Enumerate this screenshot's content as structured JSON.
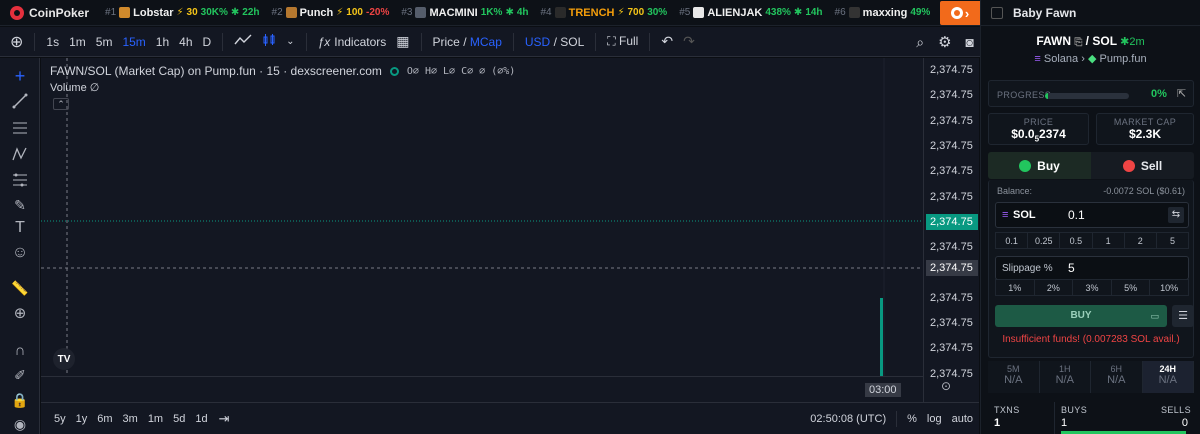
{
  "ticker": {
    "brand": "CoinPoker",
    "items": [
      {
        "rank": "#1",
        "symbol": "Lobstar",
        "cap": "30",
        "change": "30K%",
        "age": "22h",
        "dir": "up",
        "thumb": "#d08a2c"
      },
      {
        "rank": "#2",
        "symbol": "Punch",
        "cap": "100",
        "change": "-20%",
        "age": "",
        "dir": "down",
        "thumb": "#b5782f"
      },
      {
        "rank": "#3",
        "symbol": "MACMINI",
        "cap": "",
        "change": "1K%",
        "age": "4h",
        "dir": "up",
        "thumb": "#555d6b"
      },
      {
        "rank": "#4",
        "symbol": "TRENCH",
        "cap": "700",
        "change": "30%",
        "age": "",
        "dir": "up",
        "thumb": "#2a2a2a",
        "symbol_color": "#f59e0b"
      },
      {
        "rank": "#5",
        "symbol": "ALIENJAK",
        "cap": "",
        "change": "438%",
        "age": "14h",
        "dir": "up",
        "thumb": "#e8e8e8"
      },
      {
        "rank": "#6",
        "symbol": "maxxing",
        "cap": "",
        "change": "49%",
        "age": "",
        "dir": "up",
        "thumb": "#333"
      }
    ]
  },
  "toolbar": {
    "intervals": [
      "1s",
      "1m",
      "5m",
      "15m",
      "1h",
      "4h",
      "D"
    ],
    "active_interval": "15m",
    "indicators": "Indicators",
    "price": "Price",
    "mcap": "MCap",
    "usd": "USD",
    "sol": "SOL",
    "full": "Full"
  },
  "chart": {
    "title": "FAWN/SOL (Market Cap) on Pump.fun · 15 · dexscreener.com",
    "ohlc": "O∅ H∅ L∅ C∅ ∅ (∅%)",
    "volume": "Volume ∅",
    "price_ticks": [
      "2,374.75",
      "2,374.75",
      "2,374.75",
      "2,374.75",
      "2,374.75",
      "2,374.75",
      "2,374.75",
      "2,374.75",
      "2,374.75",
      "2,374.75",
      "2,374.75",
      "2,374.75",
      "2,374.75"
    ],
    "current_price": "2,374.75",
    "crosshair_price": "2,374.75",
    "time_label": "03:00",
    "ranges": [
      "5y",
      "1y",
      "6m",
      "3m",
      "1m",
      "5d",
      "1d"
    ],
    "clock": "02:50:08 (UTC)",
    "pct": "%",
    "log": "log",
    "auto": "auto",
    "tv": "TV"
  },
  "panel": {
    "header": "Baby Fawn",
    "pair_base": "FAWN",
    "pair_quote": "SOL",
    "age": "2m",
    "chain": "Solana",
    "dex": "Pump.fun",
    "progress_label": "PROGRESS",
    "progress_pct": "0%",
    "progress_value": 0.03,
    "price_label": "PRICE",
    "price_value": "$0.0",
    "price_sub": "5",
    "price_tail": "2374",
    "mcap_label": "MARKET CAP",
    "mcap_value": "$2.3K",
    "buy_tab": "Buy",
    "sell_tab": "Sell",
    "balance_label": "Balance:",
    "balance_value": "-0.0072 SOL ($0.61)",
    "token": "SOL",
    "amount": "0.1",
    "quick_amounts": [
      "0.1",
      "0.25",
      "0.5",
      "1",
      "2",
      "5"
    ],
    "slippage_label": "Slippage %",
    "slippage_value": "5",
    "slippage_opts": [
      "1%",
      "2%",
      "3%",
      "5%",
      "10%"
    ],
    "buy_button": "BUY",
    "error": "Insufficient funds! (0.007283 SOL avail.)",
    "timeframes": [
      {
        "t": "5M",
        "v": "N/A"
      },
      {
        "t": "1H",
        "v": "N/A"
      },
      {
        "t": "6H",
        "v": "N/A"
      },
      {
        "t": "24H",
        "v": "N/A"
      }
    ],
    "txns_label": "TXNS",
    "txns_value": "1",
    "buys_label": "BUYS",
    "buys_value": "1",
    "sells_label": "SELLS",
    "sells_value": "0"
  }
}
